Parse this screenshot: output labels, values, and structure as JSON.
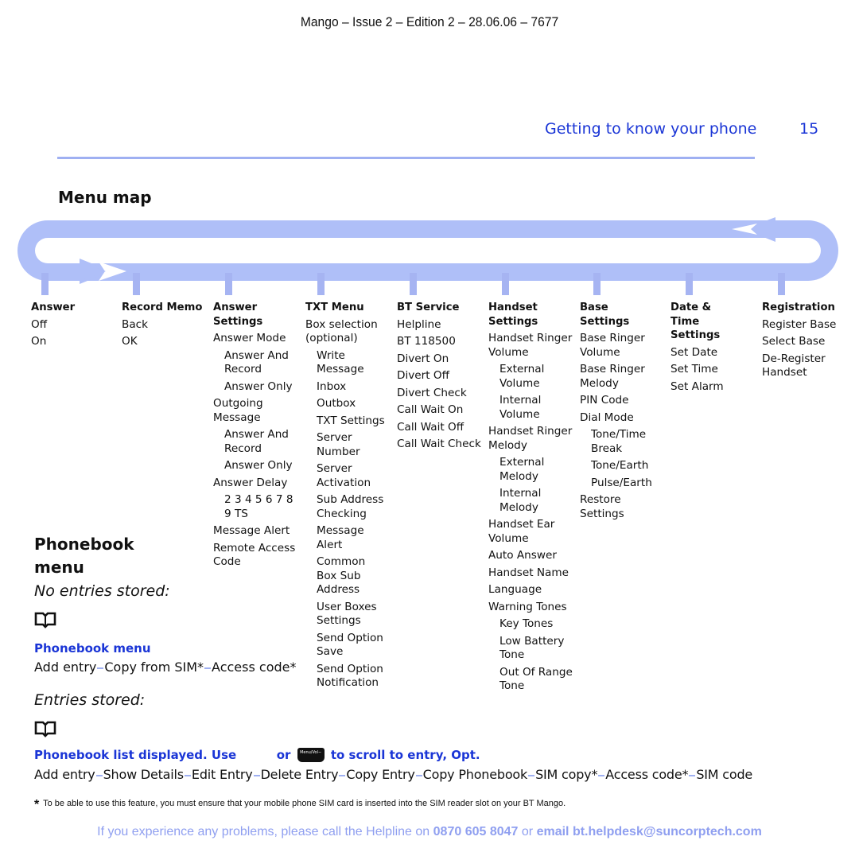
{
  "doc_header": "Mango – Issue 2 – Edition 2 – 28.06.06 – 7677",
  "page": {
    "section_title": "Getting to know your phone",
    "page_number": "15",
    "accent_color": "#1a35d6",
    "rule_color": "#9fb0f2"
  },
  "menu_map": {
    "title": "Menu map",
    "columns": [
      {
        "heading": "Answer",
        "items": [
          {
            "text": "Off",
            "level": 0
          },
          {
            "text": "On",
            "level": 0
          }
        ]
      },
      {
        "heading": "Record Memo",
        "items": [
          {
            "text": "Back",
            "level": 0
          },
          {
            "text": "OK",
            "level": 0
          }
        ]
      },
      {
        "heading": "Answer Settings",
        "items": [
          {
            "text": "Answer Mode",
            "level": 0
          },
          {
            "text": "Answer And Record",
            "level": 1
          },
          {
            "text": "Answer Only",
            "level": 1
          },
          {
            "text": "Outgoing Message",
            "level": 0
          },
          {
            "text": "Answer And Record",
            "level": 1
          },
          {
            "text": "Answer Only",
            "level": 1
          },
          {
            "text": "Answer Delay",
            "level": 0
          },
          {
            "text": "2 3 4 5 6 7 8 9 TS",
            "level": 1
          },
          {
            "text": "Message Alert",
            "level": 0
          },
          {
            "text": "Remote Access Code",
            "level": 0
          }
        ]
      },
      {
        "heading": "TXT Menu",
        "items": [
          {
            "text": "Box selection (optional)",
            "level": 0
          },
          {
            "text": "Write Message",
            "level": 1
          },
          {
            "text": "Inbox",
            "level": 1
          },
          {
            "text": "Outbox",
            "level": 1
          },
          {
            "text": "TXT Settings",
            "level": 1
          },
          {
            "text": "Server Number",
            "level": 1
          },
          {
            "text": "Server Activation",
            "level": 1
          },
          {
            "text": "Sub Address Checking",
            "level": 1
          },
          {
            "text": "Message Alert",
            "level": 1
          },
          {
            "text": "Common Box Sub Address",
            "level": 1
          },
          {
            "text": "User Boxes Settings",
            "level": 1
          },
          {
            "text": "Send Option Save",
            "level": 1
          },
          {
            "text": "Send Option Notification",
            "level": 1
          }
        ]
      },
      {
        "heading": "BT Service",
        "items": [
          {
            "text": "Helpline",
            "level": 0
          },
          {
            "text": "BT 118500",
            "level": 0
          },
          {
            "text": "Divert On",
            "level": 0
          },
          {
            "text": "Divert Off",
            "level": 0
          },
          {
            "text": "Divert Check",
            "level": 0
          },
          {
            "text": "Call Wait On",
            "level": 0
          },
          {
            "text": "Call Wait Off",
            "level": 0
          },
          {
            "text": "Call Wait Check",
            "level": 0
          }
        ]
      },
      {
        "heading": "Handset Settings",
        "items": [
          {
            "text": "Handset Ringer Volume",
            "level": 0
          },
          {
            "text": "External Volume",
            "level": 1
          },
          {
            "text": "Internal Volume",
            "level": 1
          },
          {
            "text": "Handset Ringer Melody",
            "level": 0
          },
          {
            "text": "External Melody",
            "level": 1
          },
          {
            "text": "Internal Melody",
            "level": 1
          },
          {
            "text": "Handset Ear Volume",
            "level": 0
          },
          {
            "text": "Auto Answer",
            "level": 0
          },
          {
            "text": "Handset Name",
            "level": 0
          },
          {
            "text": "Language",
            "level": 0
          },
          {
            "text": "Warning Tones",
            "level": 0
          },
          {
            "text": "Key Tones",
            "level": 1
          },
          {
            "text": "Low Battery Tone",
            "level": 1
          },
          {
            "text": "Out Of Range Tone",
            "level": 1
          }
        ]
      },
      {
        "heading": "Base Settings",
        "items": [
          {
            "text": "Base Ringer Volume",
            "level": 0
          },
          {
            "text": "Base Ringer Melody",
            "level": 0
          },
          {
            "text": "PIN Code",
            "level": 0
          },
          {
            "text": "Dial Mode",
            "level": 0
          },
          {
            "text": "Tone/Time Break",
            "level": 1
          },
          {
            "text": "Tone/Earth",
            "level": 1
          },
          {
            "text": "Pulse/Earth",
            "level": 1
          },
          {
            "text": "Restore Settings",
            "level": 0
          }
        ]
      },
      {
        "heading": "Date & Time Settings",
        "items": [
          {
            "text": "Set Date",
            "level": 0
          },
          {
            "text": "Set Time",
            "level": 0
          },
          {
            "text": "Set Alarm",
            "level": 0
          }
        ]
      },
      {
        "heading": "Registration",
        "items": [
          {
            "text": "Register Base",
            "level": 0
          },
          {
            "text": "Select Base",
            "level": 0
          },
          {
            "text": "De-Register Handset",
            "level": 0
          }
        ]
      }
    ]
  },
  "phonebook": {
    "title": "Phonebook menu",
    "no_entries_label": "No entries stored:",
    "book_icon": "phonebook-icon",
    "menu_label": "Phonebook menu",
    "menu_path": [
      "Add entry",
      "Copy from SIM*",
      "Access code*"
    ],
    "entries_label": "Entries stored:",
    "list_label_part1": "Phonebook list displayed. Use",
    "list_label_or": "or",
    "menu_key_label": "Menu/Vol−",
    "list_label_part2": "to scroll to entry, Opt.",
    "list_path": [
      "Add entry",
      "Show Details",
      "Edit Entry",
      "Delete Entry",
      "Copy Entry",
      "Copy Phonebook",
      "SIM copy*",
      "Access code*",
      "SIM code"
    ]
  },
  "footnote": {
    "star": "*",
    "text": "To be able to use this feature, you must ensure that your mobile phone SIM card is inserted into the SIM reader slot on your BT Mango."
  },
  "helpline": {
    "prefix": "If you experience any problems, please call the Helpline on",
    "phone": "0870 605 8047",
    "or": "or",
    "email": "email bt.helpdesk@suncorptech.com"
  }
}
